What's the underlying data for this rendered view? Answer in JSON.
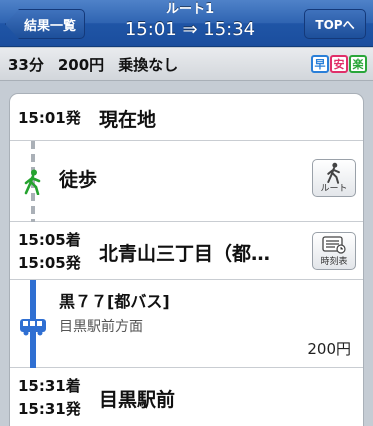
{
  "navbar": {
    "back_label": "結果一覧",
    "title": "ルート1",
    "time_range": "15:01 ⇒ 15:34",
    "top_label": "TOPへ"
  },
  "summary": {
    "duration": "33分",
    "fare": "200円",
    "transfers": "乗換なし",
    "badges": [
      "早",
      "安",
      "楽"
    ]
  },
  "route": {
    "departure": {
      "time": "15:01発",
      "place": "現在地"
    },
    "walk": {
      "label": "徒歩",
      "button_label": "ルート"
    },
    "stop": {
      "arrive": "15:05着",
      "depart": "15:05発",
      "place": "北青山三丁目（都…",
      "button_label": "時刻表"
    },
    "bus": {
      "name": "黒７７[都バス]",
      "direction": "目黒駅前方面",
      "fare": "200円"
    },
    "arrival": {
      "arrive": "15:31着",
      "depart": "15:31発",
      "place": "目黒駅前"
    }
  }
}
